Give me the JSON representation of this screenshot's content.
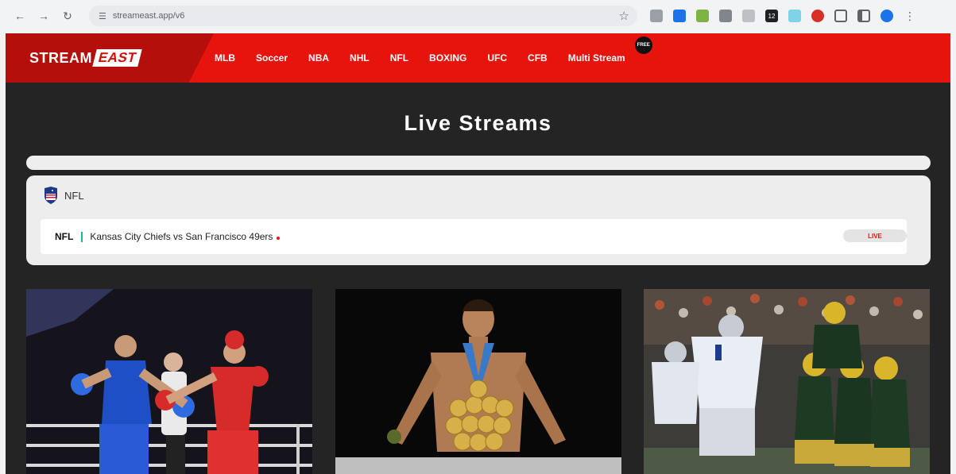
{
  "browser": {
    "url": "streameast.app/v6",
    "ext_badge": "12"
  },
  "site": {
    "logo": {
      "part1": "STREAM",
      "part2": "EAST"
    },
    "nav": [
      {
        "label": "MLB"
      },
      {
        "label": "Soccer"
      },
      {
        "label": "NBA"
      },
      {
        "label": "NHL"
      },
      {
        "label": "NFL"
      },
      {
        "label": "BOXING"
      },
      {
        "label": "UFC"
      },
      {
        "label": "CFB"
      },
      {
        "label": "Multi Stream"
      }
    ],
    "free_badge": "FREE",
    "page_title": "Live Streams",
    "league": {
      "name": "NFL",
      "game": {
        "league": "NFL",
        "title": "Kansas City Chiefs vs San Francisco 49ers",
        "status": "LIVE"
      }
    }
  },
  "colors": {
    "header_red": "#e6140d",
    "logo_dark_red": "#b40f0a",
    "page_bg": "#242424",
    "separator_teal": "#17b7a0"
  }
}
